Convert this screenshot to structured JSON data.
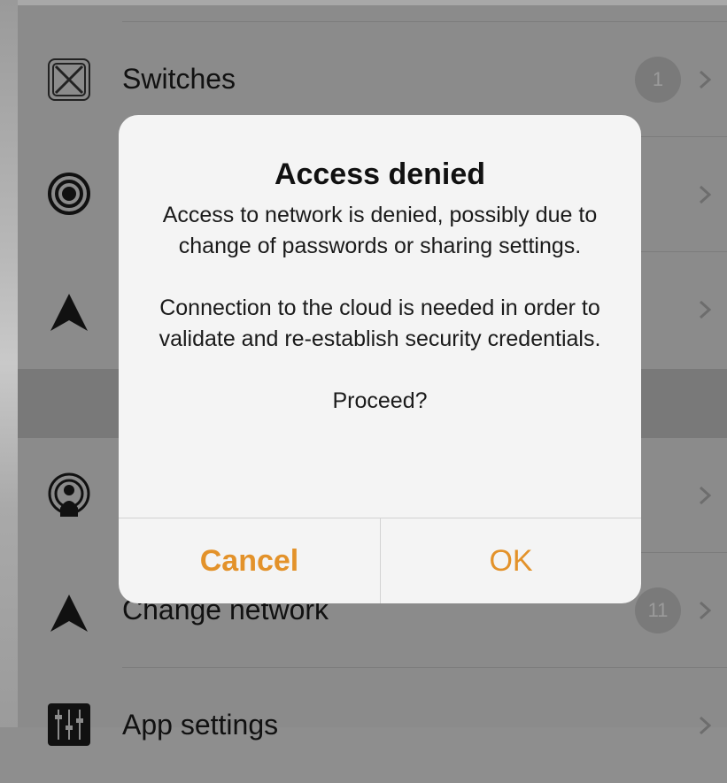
{
  "list": {
    "items": [
      {
        "label": "Switches",
        "badge": "1",
        "icon": "switch-x-icon"
      },
      {
        "label": "",
        "badge": "",
        "icon": "target-icon"
      },
      {
        "label": "",
        "badge": "",
        "icon": "navigation-arrow-icon"
      },
      {
        "label": "",
        "badge": "",
        "icon": "broadcast-person-icon"
      },
      {
        "label": "Change network",
        "badge": "11",
        "icon": "navigation-arrow-icon"
      },
      {
        "label": "App settings",
        "badge": "",
        "icon": "sliders-icon"
      }
    ]
  },
  "alert": {
    "title": "Access denied",
    "message_1": "Access to network is denied, possibly due to change of passwords or sharing settings.",
    "message_2": "Connection to the cloud is needed in order to validate and re-establish security credentials.",
    "message_3": "Proceed?",
    "cancel_label": "Cancel",
    "ok_label": "OK"
  },
  "colors": {
    "accent": "#e3922a",
    "dim_background": "#8b8b8b",
    "alert_background": "#f4f4f4"
  }
}
